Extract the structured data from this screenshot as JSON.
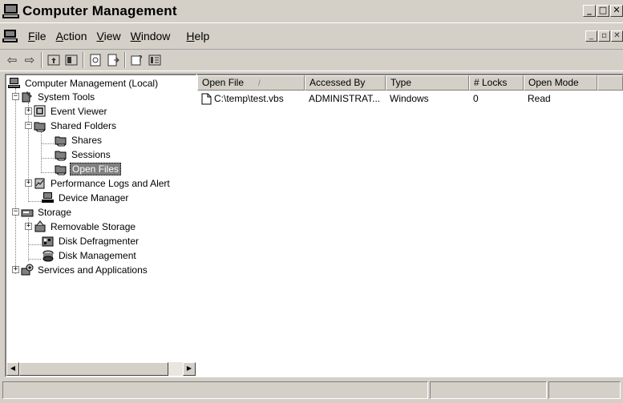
{
  "window": {
    "title": "Computer Management",
    "buttons": {
      "minimize": "_",
      "maximize": "□",
      "close": "✕"
    }
  },
  "menu": {
    "items": [
      {
        "accel": "F",
        "rest": "ile"
      },
      {
        "accel": "A",
        "rest": "ction"
      },
      {
        "accel": "V",
        "rest": "iew"
      },
      {
        "accel": "W",
        "rest": "indow"
      },
      {
        "accel": "H",
        "rest": "elp"
      }
    ]
  },
  "tree": {
    "root": "Computer Management (Local)",
    "system_tools": "System Tools",
    "event_viewer": "Event Viewer",
    "shared_folders": "Shared Folders",
    "shares": "Shares",
    "sessions": "Sessions",
    "open_files": "Open Files",
    "perf_logs": "Performance Logs and Alert",
    "device_manager": "Device Manager",
    "storage": "Storage",
    "removable_storage": "Removable Storage",
    "disk_defrag": "Disk Defragmenter",
    "disk_management": "Disk Management",
    "services": "Services and Applications"
  },
  "list": {
    "columns": [
      "Open File",
      "Accessed By",
      "Type",
      "# Locks",
      "Open Mode"
    ],
    "sort_indicator": "/",
    "rows": [
      [
        "C:\\temp\\test.vbs",
        "ADMINISTRAT...",
        "Windows",
        "0",
        "Read"
      ]
    ]
  },
  "colors": {
    "face": "#d4d0c8",
    "selection": "#808080"
  }
}
